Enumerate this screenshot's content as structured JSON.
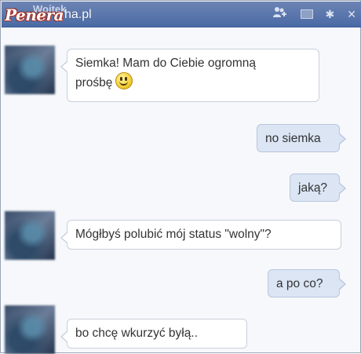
{
  "header": {
    "contact_name": "Wojtek",
    "watermark_brand": "Penera",
    "watermark_domain": "ha.pl",
    "icons": [
      "add-friend-icon",
      "video-icon",
      "gear-icon",
      "close-icon"
    ]
  },
  "messages": [
    {
      "side": "in",
      "line1": "Siemka! Mam do Ciebie ogromną",
      "line2": "prośbę",
      "emoticon": "smiley-icon"
    },
    {
      "side": "out",
      "text": "no siemka"
    },
    {
      "side": "out",
      "text": "jaką?"
    },
    {
      "side": "in",
      "text": "Mógłbyś polubić mój status \"wolny\"?"
    },
    {
      "side": "out",
      "text": "a po co?"
    },
    {
      "side": "in",
      "text": "bo chcę wkurzyć byłą.."
    }
  ],
  "colors": {
    "header_blue": "#4a6aa5",
    "incoming_bubble": "#ffffff",
    "outgoing_bubble": "#dbe5f4",
    "bubble_border": "#c7cfdc"
  }
}
